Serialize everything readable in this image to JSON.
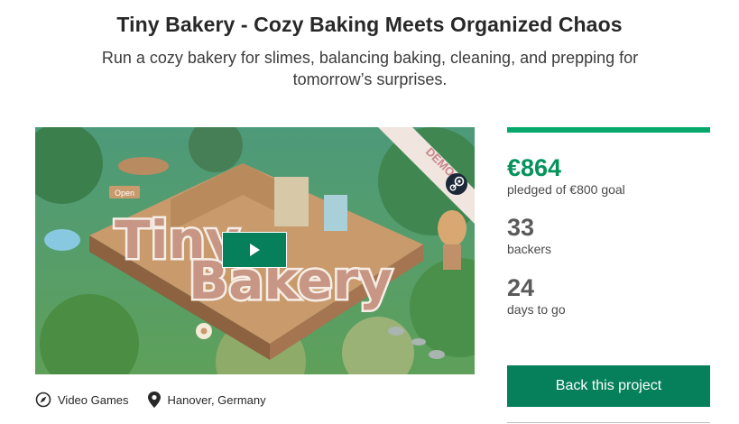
{
  "project": {
    "title": "Tiny Bakery - Cozy Baking Meets Organized Chaos",
    "blurb": "Run a cozy bakery for slimes, balancing baking, cleaning, and prepping for tomorrow’s surprises."
  },
  "media": {
    "logo_line1": "Tiny",
    "logo_line2": "Bakery",
    "ribbon_text": "DEMO",
    "sign_text": "Open",
    "play_icon": "play-icon",
    "platform_icon": "steam-icon"
  },
  "meta": {
    "category": "Video Games",
    "category_icon": "compass-icon",
    "location": "Hanover, Germany",
    "location_icon": "map-pin-icon"
  },
  "stats": {
    "pledged": "€864",
    "pledged_label": "pledged of €800 goal",
    "funded_fraction": 1.0,
    "backers": "33",
    "backers_label": "backers",
    "days": "24",
    "days_label": "days to go"
  },
  "actions": {
    "back_label": "Back this project"
  },
  "colors": {
    "accent": "#05805a",
    "funded": "#05935c"
  }
}
